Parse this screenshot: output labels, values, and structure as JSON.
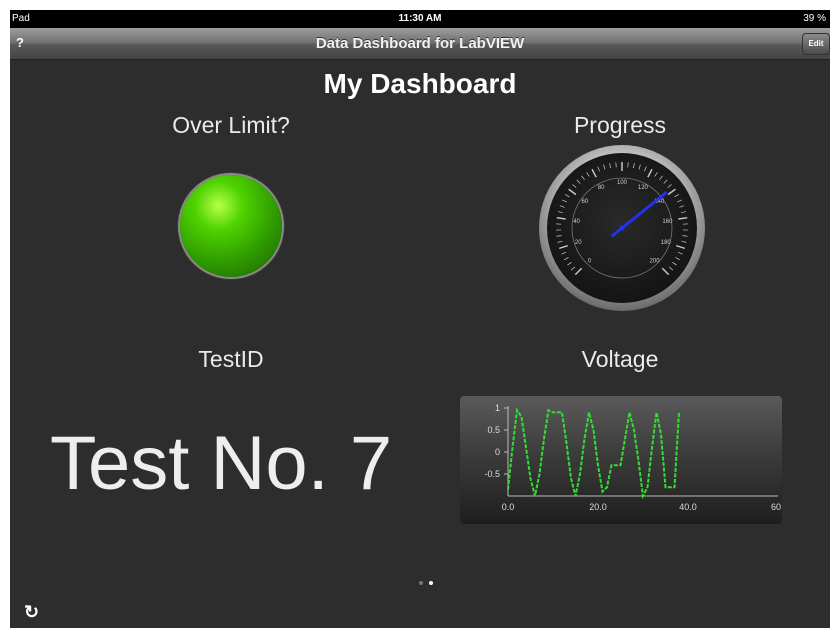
{
  "status_bar": {
    "device": "Pad",
    "time": "11:30 AM",
    "battery": "39 %"
  },
  "nav": {
    "help": "?",
    "title": "Data Dashboard for LabVIEW",
    "edit": "Edit"
  },
  "dashboard": {
    "title": "My Dashboard",
    "over_limit": {
      "label": "Over Limit?",
      "state": "on",
      "color": "#44cc00"
    },
    "progress": {
      "label": "Progress",
      "ticks": [
        "0",
        "20",
        "40",
        "60",
        "80",
        "100",
        "120",
        "140",
        "160",
        "180",
        "200"
      ],
      "min": 0,
      "max": 200,
      "value": 138
    },
    "test_id": {
      "label": "TestID",
      "value": "Test No. 7"
    },
    "voltage": {
      "label": "Voltage",
      "line_color": "#33dd33"
    }
  },
  "chart_data": {
    "type": "line",
    "title": "Voltage",
    "ylim": [
      -1,
      1
    ],
    "xlim": [
      0,
      60
    ],
    "yticks": [
      "1",
      "0.5",
      "0",
      "-0.5"
    ],
    "xticks": [
      "0.0",
      "20.0",
      "40.0",
      "60"
    ],
    "series": [
      {
        "x": [
          0,
          1,
          2,
          3,
          4,
          5,
          6,
          7,
          8,
          9,
          10,
          11,
          12,
          13,
          14,
          15,
          16,
          17,
          18,
          19,
          20,
          21,
          22,
          23,
          24,
          25,
          26,
          27,
          28,
          29,
          30,
          31,
          32,
          33,
          34,
          35,
          36,
          37,
          38
        ],
        "y": [
          -0.85,
          0.1,
          0.95,
          0.8,
          0.1,
          -0.6,
          -1,
          -0.5,
          0.3,
          0.95,
          0.9,
          0.9,
          0.9,
          0.2,
          -0.6,
          -1,
          -0.5,
          0.3,
          0.9,
          0.5,
          -0.3,
          -0.9,
          -0.8,
          -0.3,
          -0.3,
          -0.3,
          0.3,
          0.9,
          0.5,
          -0.2,
          -1,
          -0.8,
          0.1,
          0.9,
          0.4,
          -0.8,
          -0.8,
          -0.8,
          0.9
        ]
      }
    ]
  },
  "pager": {
    "pages": 2,
    "current": 1
  },
  "refresh_icon": "↻"
}
